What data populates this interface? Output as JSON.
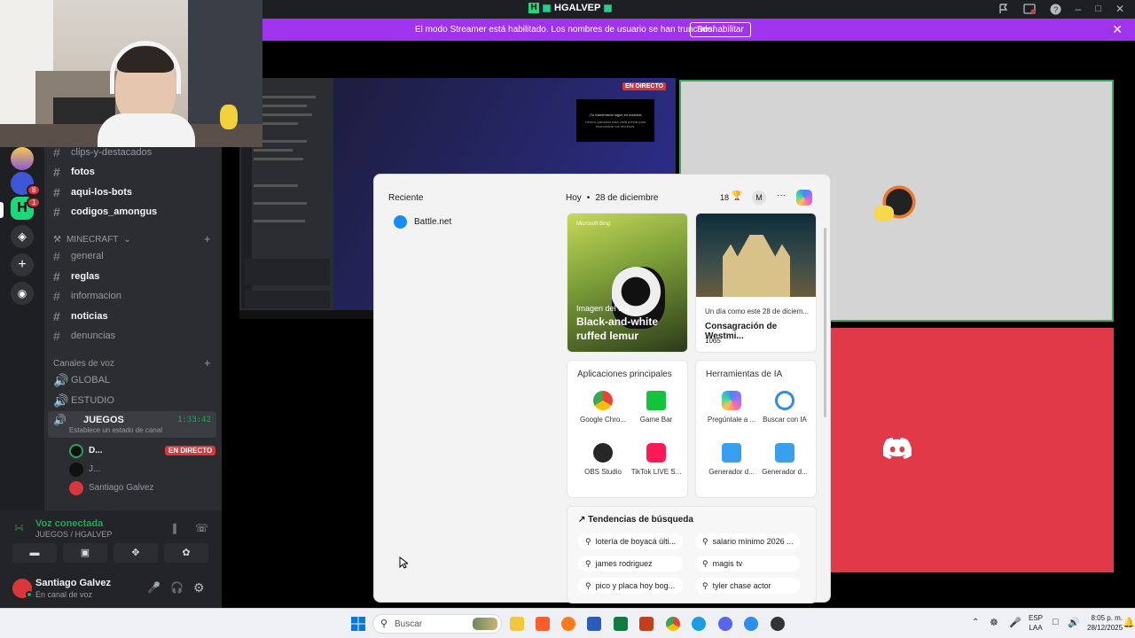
{
  "window": {
    "title": "HGALVEP",
    "streamer_banner": "El modo Streamer está habilitado. Los nombres de usuario se han truncado.",
    "disable_button": "Deshabilitar"
  },
  "server_badges": [
    "8",
    "1"
  ],
  "channels": [
    {
      "name": "clips-y-destacados",
      "bold": false
    },
    {
      "name": "fotos",
      "bold": true
    },
    {
      "name": "aqui-los-bots",
      "bold": true
    },
    {
      "name": "codigos_amongus",
      "bold": true
    },
    {
      "name": "general",
      "bold": false
    },
    {
      "name": "reglas",
      "bold": true
    },
    {
      "name": "informacion",
      "bold": false
    },
    {
      "name": "noticias",
      "bold": true
    },
    {
      "name": "denuncias",
      "bold": false
    }
  ],
  "categories": {
    "minecraft": "MINECRAFT",
    "voice": "Canales de voz"
  },
  "voice_channels": [
    {
      "name": "GLOBAL"
    },
    {
      "name": "ESTUDIO"
    },
    {
      "name": "JUEGOS",
      "time": "1:33:42",
      "status": "Establece un estado de canal"
    }
  ],
  "voice_users": [
    {
      "name": "D...",
      "live": "EN DIRECTO"
    },
    {
      "name": "J..."
    },
    {
      "name": "Santiago Galvez"
    }
  ],
  "voice_panel": {
    "status": "Voz conectada",
    "location": "JUEGOS / HGALVEP"
  },
  "user_panel": {
    "name": "Santiago Galvez",
    "status": "En canal de voz"
  },
  "stream": {
    "live_badge": "EN DIRECTO",
    "popup_title": "¡Tu transmisión sigue en marcha!",
    "popup_text": "Hemos pausado esta vista previa para economizar los recursos."
  },
  "start_menu": {
    "recent_title": "Reciente",
    "recent_items": [
      "Battle.net"
    ],
    "today_label": "Hoy",
    "date": "28 de diciembre",
    "weather_temp": "18",
    "profile_initial": "M",
    "more": "···",
    "photo_card": {
      "source": "Microsoft Bing",
      "caption_small": "Imagen del día",
      "caption": "Black-and-white ruffed lemur"
    },
    "history_card": {
      "title_small": "Un día como este 28 de diciem...",
      "title": "Consagración de Westmi...",
      "year": "1065"
    },
    "apps_title": "Aplicaciones principales",
    "apps": [
      "Google Chro...",
      "Game Bar",
      "OBS Studio",
      "TikTok LIVE S..."
    ],
    "ai_title": "Herramientas de IA",
    "ai_tools": [
      "Pregúntale a ...",
      "Buscar con IA",
      "Generador d...",
      "Generador d..."
    ],
    "trends_title": "Tendencias de búsqueda",
    "trends": [
      "lotería de boyacá últi...",
      "salario mínimo 2026 ...",
      "james rodriguez",
      "magis tv",
      "pico y placa hoy bog...",
      "tyler chase actor"
    ]
  },
  "taskbar": {
    "search_placeholder": "Buscar",
    "lang1": "ESP",
    "lang2": "LAA",
    "time": "8:05 p. m.",
    "date": "28/12/2025"
  },
  "colors": {
    "discord_blurple": "#5865f2",
    "streamer_purple": "#a033ee",
    "live_red": "#da373c",
    "voice_green": "#23a55a"
  }
}
